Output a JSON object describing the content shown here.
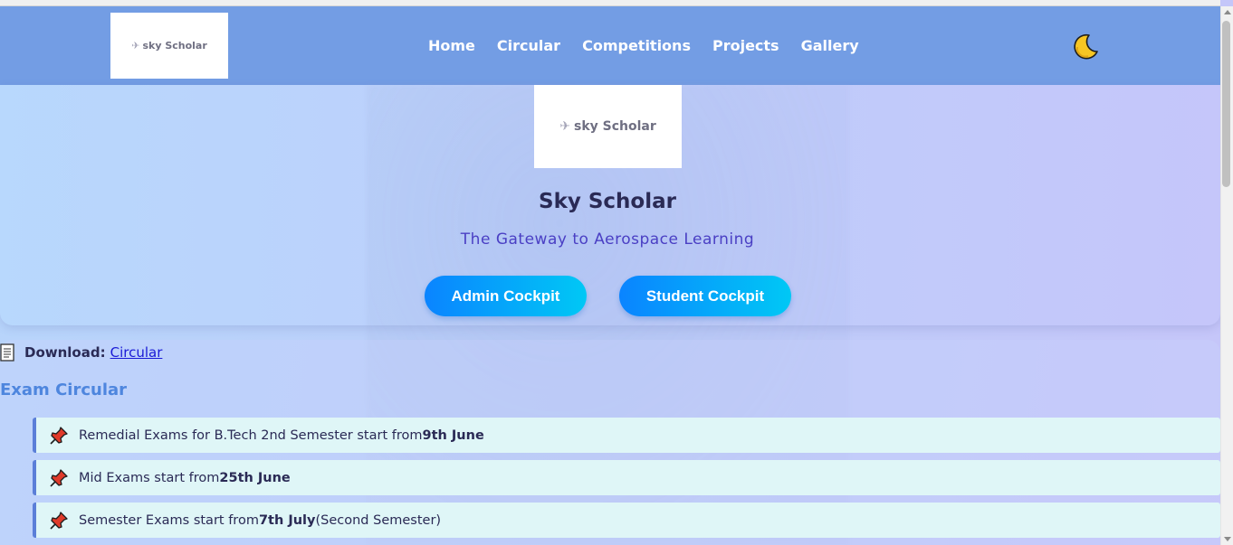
{
  "brand": {
    "logo_text": "sky Scholar"
  },
  "nav": {
    "items": [
      {
        "label": "Home"
      },
      {
        "label": "Circular"
      },
      {
        "label": "Competitions"
      },
      {
        "label": "Projects"
      },
      {
        "label": "Gallery"
      }
    ],
    "theme_toggle_icon": "moon-icon"
  },
  "hero": {
    "logo_text": "sky Scholar",
    "title": "Sky Scholar",
    "subtitle": "The Gateway to Aerospace Learning",
    "admin_button": "Admin Cockpit",
    "student_button": "Student Cockpit"
  },
  "download": {
    "label": "Download:",
    "link_text": "Circular",
    "icon": "document-icon"
  },
  "exam_circular": {
    "title": "Exam Circular",
    "notices": [
      {
        "prefix": "Remedial Exams for B.Tech 2nd Semester start from",
        "bold": "9th June",
        "suffix": ""
      },
      {
        "prefix": "Mid Exams start from",
        "bold": "25th June",
        "suffix": ""
      },
      {
        "prefix": "Semester Exams start from",
        "bold": "7th July",
        "suffix": "(Second Semester)"
      }
    ],
    "notice_icon": "pushpin-icon"
  },
  "colors": {
    "navbar": "#739de4",
    "button_gradient_start": "#0a84ff",
    "button_gradient_end": "#00c8f5",
    "subtitle": "#4a3fc4",
    "section_title": "#4e86de",
    "notice_bg": "#dff6f7"
  }
}
